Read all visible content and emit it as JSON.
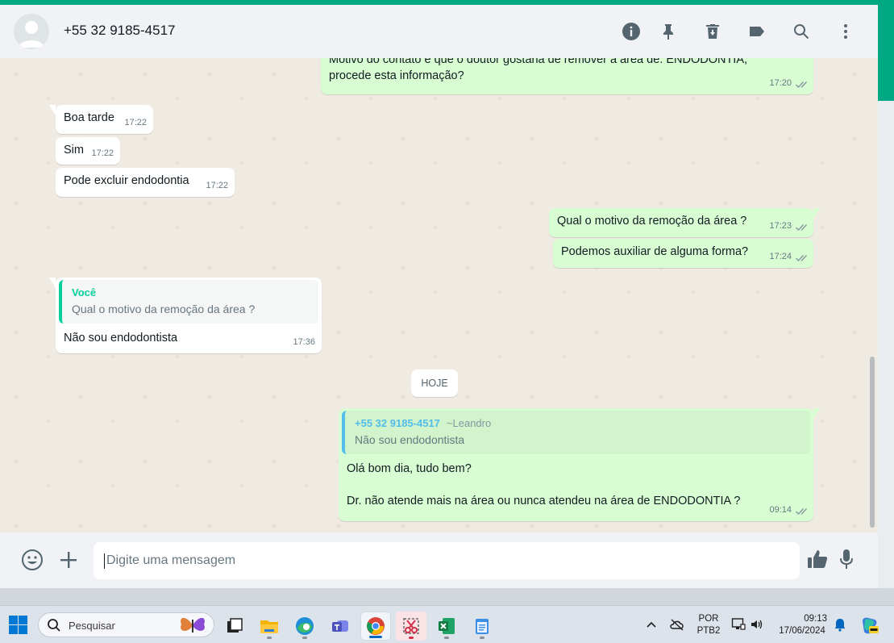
{
  "header": {
    "contact_name": "+55 32 9185-4517"
  },
  "messages": {
    "m0": {
      "text_line1": "Motivo do contato é que o doutor gostaria de remover a área de: ENDODONTIA,",
      "text_line2": "procede esta informação?",
      "time": "17:20"
    },
    "m1": {
      "text": "Boa tarde",
      "time": "17:22"
    },
    "m2": {
      "text": "Sim",
      "time": "17:22"
    },
    "m3": {
      "text": "Pode excluir endodontia",
      "time": "17:22"
    },
    "m4": {
      "text": "Qual o motivo da remoção da área ?",
      "time": "17:23"
    },
    "m5": {
      "text": "Podemos auxiliar de alguma forma?",
      "time": "17:24"
    },
    "m6": {
      "quote_author": "Você",
      "quote_text": "Qual o motivo da remoção da área ?",
      "text": "Não sou endodontista",
      "time": "17:36"
    },
    "day_chip": "HOJE",
    "m7": {
      "quote_author": "+55 32 9185-4517",
      "quote_author_sub": "~Leandro",
      "quote_text": "Não sou endodontista",
      "text_line1": "Olá bom dia, tudo bem?",
      "text_line2": "Dr. não atende mais na área ou nunca atendeu na área de ENDODONTIA ?",
      "time": "09:14"
    }
  },
  "composer": {
    "placeholder": "Digite uma mensagem"
  },
  "taskbar": {
    "search_label": "Pesquisar",
    "lang_line1": "POR",
    "lang_line2": "PTB2",
    "clock_time": "09:13",
    "clock_date": "17/06/2024"
  },
  "colors": {
    "accent": "#00a884",
    "outgoing_bubble": "#d9fdd3",
    "incoming_bubble": "#ffffff",
    "chat_background": "#efeae2"
  }
}
